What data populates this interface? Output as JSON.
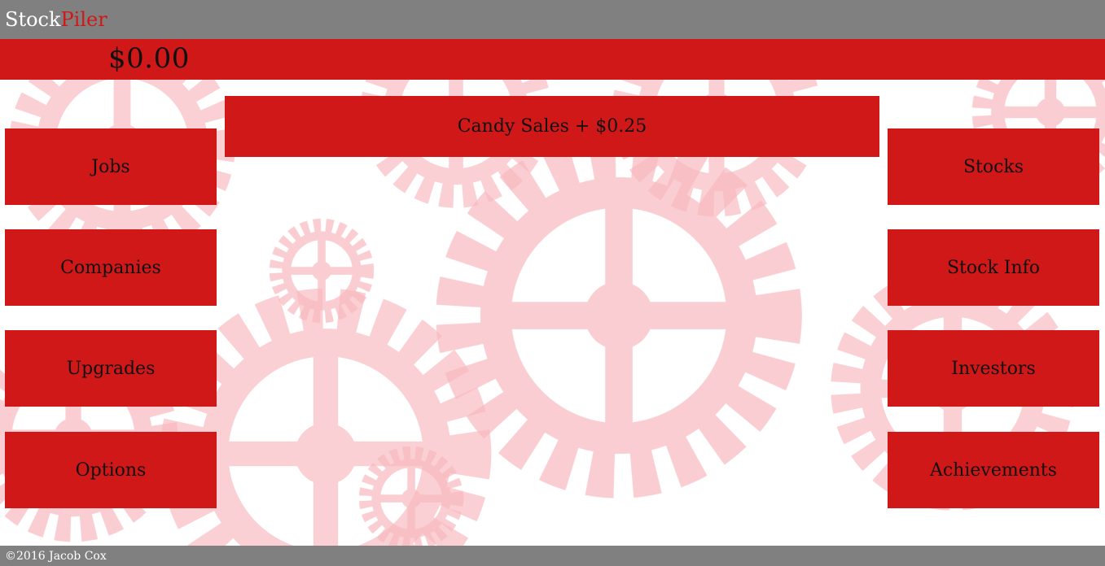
{
  "header": {
    "logo_part1": "Stock",
    "logo_part2": "Piler"
  },
  "balance": "$0.00",
  "actions": {
    "candy_sales": "Candy Sales + $0.25"
  },
  "left_menu": [
    "Jobs",
    "Companies",
    "Upgrades",
    "Options"
  ],
  "right_menu": [
    "Stocks",
    "Stock Info",
    "Investors",
    "Achievements"
  ],
  "footer": {
    "copyright": "©2016 Jacob Cox"
  },
  "colors": {
    "accent": "#d01818",
    "header_bg": "#808080",
    "gear_tint": "#f7b8bd"
  },
  "background_icon": "gears-pattern"
}
